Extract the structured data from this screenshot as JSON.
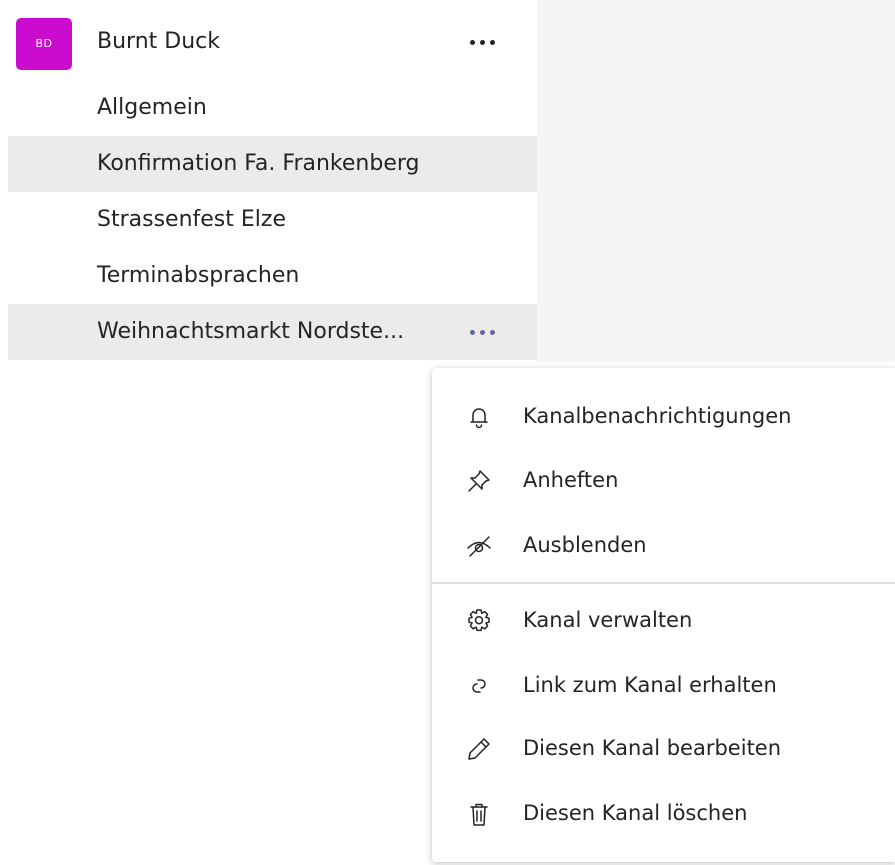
{
  "team": {
    "avatar_initials": "BD",
    "avatar_color": "#cc0bd1",
    "name": "Burnt Duck"
  },
  "channels": [
    {
      "label": "Allgemein",
      "highlighted": false
    },
    {
      "label": "Konfirmation Fa. Frankenberg",
      "highlighted": true
    },
    {
      "label": "Strassenfest Elze",
      "highlighted": false
    },
    {
      "label": "Terminabsprachen",
      "highlighted": false
    },
    {
      "label": "Weihnachtsmarkt Nordste...",
      "highlighted": true
    }
  ],
  "context_menu": {
    "items": [
      {
        "label": "Kanalbenachrichtigungen",
        "icon": "bell-icon"
      },
      {
        "label": "Anheften",
        "icon": "pin-icon"
      },
      {
        "label": "Ausblenden",
        "icon": "eye-off-icon"
      },
      {
        "label": "Kanal verwalten",
        "icon": "gear-icon"
      },
      {
        "label": "Link zum Kanal erhalten",
        "icon": "link-icon"
      },
      {
        "label": "Diesen Kanal bearbeiten",
        "icon": "pencil-icon"
      },
      {
        "label": "Diesen Kanal löschen",
        "icon": "trash-icon"
      }
    ]
  },
  "colors": {
    "accent": "#6264a7",
    "highlight_bg": "#edebe9"
  }
}
